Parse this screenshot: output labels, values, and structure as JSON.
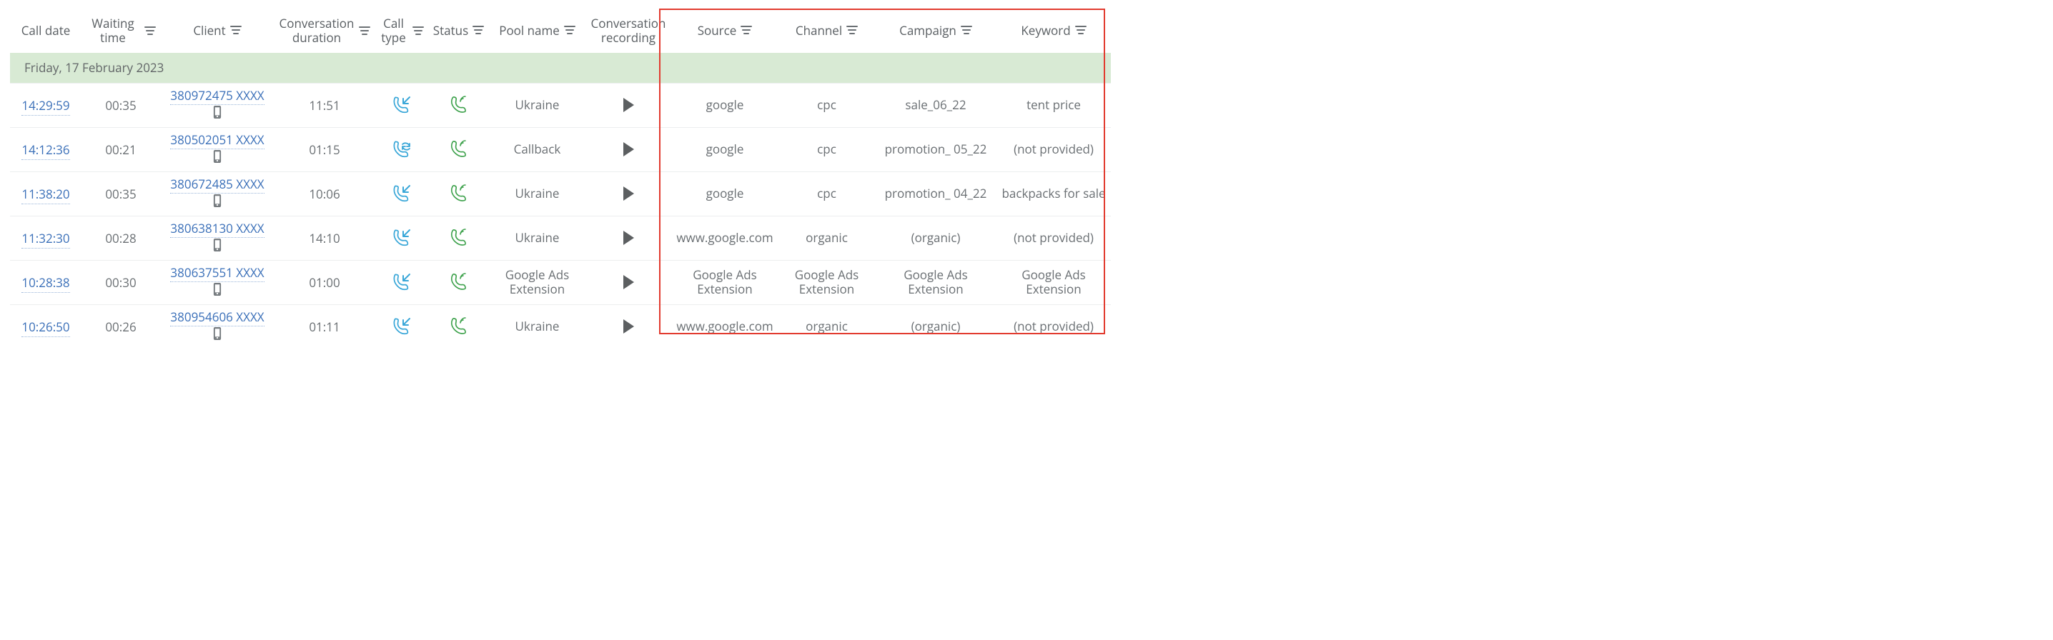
{
  "columns": [
    {
      "key": "call_date",
      "label": "Call date",
      "filter": false
    },
    {
      "key": "waiting",
      "label": "Waiting time",
      "filter": true
    },
    {
      "key": "client",
      "label": "Client",
      "filter": true
    },
    {
      "key": "duration",
      "label": "Conversation duration",
      "filter": true
    },
    {
      "key": "call_type",
      "label": "Call type",
      "filter": true
    },
    {
      "key": "status",
      "label": "Status",
      "filter": true
    },
    {
      "key": "pool",
      "label": "Pool name",
      "filter": true
    },
    {
      "key": "recording",
      "label": "Conversation recording",
      "filter": false
    },
    {
      "key": "source",
      "label": "Source",
      "filter": true
    },
    {
      "key": "channel",
      "label": "Channel",
      "filter": true
    },
    {
      "key": "campaign",
      "label": "Campaign",
      "filter": true
    },
    {
      "key": "keyword",
      "label": "Keyword",
      "filter": true
    }
  ],
  "group_date": "Friday, 17 February 2023",
  "rows": [
    {
      "time": "14:29:59",
      "waiting": "00:35",
      "client": "380972475 XXXX",
      "duration": "11:51",
      "call_type": "inbound",
      "status": "answered",
      "pool": "Ukraine",
      "source": "google",
      "channel": "cpc",
      "campaign": "sale_06_22",
      "keyword": "tent price"
    },
    {
      "time": "14:12:36",
      "waiting": "00:21",
      "client": "380502051 XXXX",
      "duration": "01:15",
      "call_type": "callback",
      "status": "answered",
      "pool": "Callback",
      "source": "google",
      "channel": "cpc",
      "campaign": "promotion_ 05_22",
      "keyword": "(not provided)"
    },
    {
      "time": "11:38:20",
      "waiting": "00:35",
      "client": "380672485 XXXX",
      "duration": "10:06",
      "call_type": "inbound",
      "status": "answered",
      "pool": "Ukraine",
      "source": "google",
      "channel": "cpc",
      "campaign": "promotion_ 04_22",
      "keyword": "backpacks for sale"
    },
    {
      "time": "11:32:30",
      "waiting": "00:28",
      "client": "380638130 XXXX",
      "duration": "14:10",
      "call_type": "inbound",
      "status": "answered",
      "pool": "Ukraine",
      "source": "www.google.com",
      "channel": "organic",
      "campaign": "(organic)",
      "keyword": "(not provided)"
    },
    {
      "time": "10:28:38",
      "waiting": "00:30",
      "client": "380637551 XXXX",
      "duration": "01:00",
      "call_type": "inbound",
      "status": "answered",
      "pool": "Google Ads Extension",
      "source": "Google Ads Extension",
      "channel": "Google Ads Extension",
      "campaign": "Google Ads Extension",
      "keyword": "Google Ads Extension"
    },
    {
      "time": "10:26:50",
      "waiting": "00:26",
      "client": "380954606 XXXX",
      "duration": "01:11",
      "call_type": "inbound",
      "status": "answered",
      "pool": "Ukraine",
      "source": "www.google.com",
      "channel": "organic",
      "campaign": "(organic)",
      "keyword": "(not provided)"
    }
  ]
}
